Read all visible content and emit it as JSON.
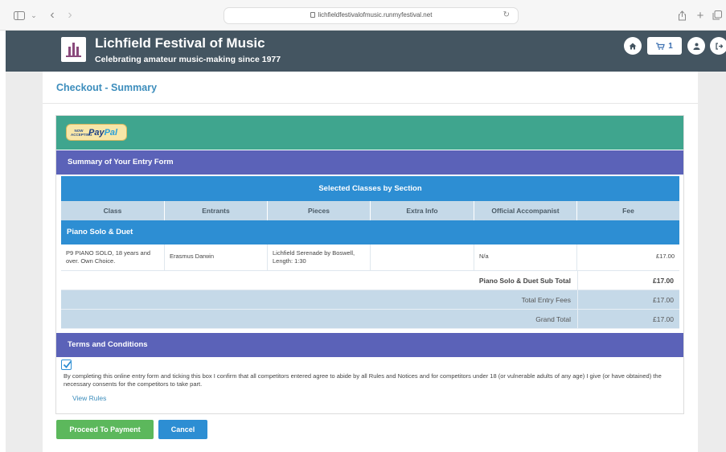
{
  "browser": {
    "url": "lichfieldfestivalofmusic.runmyfestival.net"
  },
  "site": {
    "title": "Lichfield Festival of Music",
    "subtitle": "Celebrating amateur music-making since 1977",
    "cart_count": "1"
  },
  "page": {
    "title": "Checkout - Summary"
  },
  "paypal": {
    "now_accepting": "NOW ACCEPTING",
    "brand_pay": "Pay",
    "brand_pal": "Pal"
  },
  "summary": {
    "heading": "Summary of Your Entry Form",
    "table_title": "Selected Classes by Section",
    "columns": [
      "Class",
      "Entrants",
      "Pieces",
      "Extra Info",
      "Official Accompanist",
      "Fee"
    ],
    "section": "Piano Solo & Duet",
    "rows": [
      {
        "class": "P9 PIANO SOLO, 18 years and over. Own Choice.",
        "entrants": "Erasmus Darwin",
        "pieces": "Lichfield Serenade by Boswell, Length: 1:30",
        "extra_info": "",
        "accompanist": "N/a",
        "fee": "£17.00"
      }
    ],
    "subtotal_label": "Piano Solo & Duet Sub Total",
    "subtotal_value": "£17.00",
    "total_label": "Total Entry Fees",
    "total_value": "£17.00",
    "grand_label": "Grand Total",
    "grand_value": "£17.00"
  },
  "terms": {
    "heading": "Terms and Conditions",
    "checked": true,
    "text": "By completing this online entry form and ticking this box I confirm that all competitors entered agree to abide by all Rules and Notices and for competitors under 18 (or vulnerable adults of any age) I give (or have obtained) the necessary consents for the competitors to take part.",
    "view_rules": "View Rules"
  },
  "actions": {
    "proceed": "Proceed To Payment",
    "cancel": "Cancel"
  },
  "colors": {
    "header": "#445561",
    "paypal_bar": "#3fa58e",
    "section_bar": "#5b62b8",
    "table_blue": "#2d8ed3",
    "table_tint": "#c5d9e8",
    "proceed": "#5cb85c",
    "link": "#3c8dbc"
  }
}
